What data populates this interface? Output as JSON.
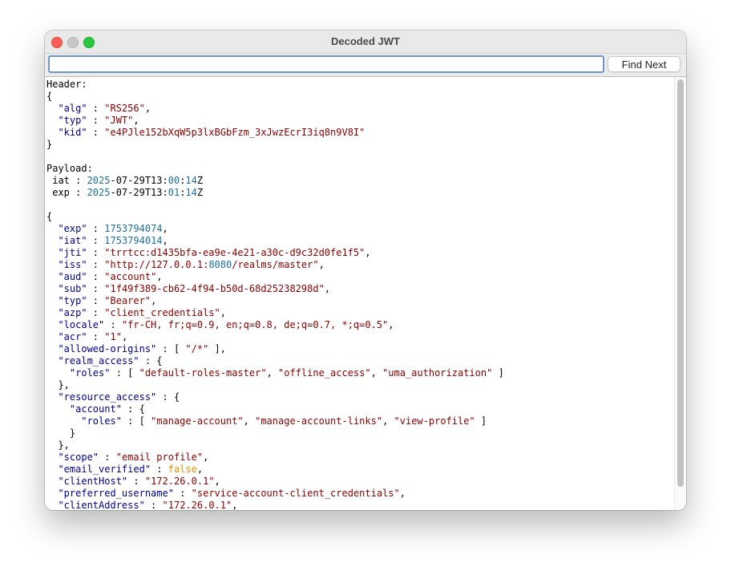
{
  "window": {
    "title": "Decoded JWT"
  },
  "find": {
    "value": "",
    "button_label": "Find Next"
  },
  "lines": [
    [
      {
        "t": "Header:",
        "c": ""
      }
    ],
    [
      {
        "t": "{",
        "c": ""
      }
    ],
    [
      {
        "t": "  ",
        "c": ""
      },
      {
        "t": "\"alg\"",
        "c": "k"
      },
      {
        "t": " : ",
        "c": ""
      },
      {
        "t": "\"RS256\"",
        "c": "s"
      },
      {
        "t": ",",
        "c": ""
      }
    ],
    [
      {
        "t": "  ",
        "c": ""
      },
      {
        "t": "\"typ\"",
        "c": "k"
      },
      {
        "t": " : ",
        "c": ""
      },
      {
        "t": "\"JWT\"",
        "c": "s"
      },
      {
        "t": ",",
        "c": ""
      }
    ],
    [
      {
        "t": "  ",
        "c": ""
      },
      {
        "t": "\"kid\"",
        "c": "k"
      },
      {
        "t": " : ",
        "c": ""
      },
      {
        "t": "\"e4PJle152bXqW5p3lxBGbFzm_3xJwzEcrI3iq8n9V8I\"",
        "c": "s"
      }
    ],
    [
      {
        "t": "}",
        "c": ""
      }
    ],
    [
      {
        "t": "",
        "c": ""
      }
    ],
    [
      {
        "t": "Payload:",
        "c": ""
      }
    ],
    [
      {
        "t": " iat : ",
        "c": ""
      },
      {
        "t": "2025",
        "c": "n"
      },
      {
        "t": "-07-29T13:",
        "c": ""
      },
      {
        "t": "00",
        "c": "n"
      },
      {
        "t": ":",
        "c": ""
      },
      {
        "t": "14",
        "c": "n"
      },
      {
        "t": "Z",
        "c": ""
      }
    ],
    [
      {
        "t": " exp : ",
        "c": ""
      },
      {
        "t": "2025",
        "c": "n"
      },
      {
        "t": "-07-29T13:",
        "c": ""
      },
      {
        "t": "01",
        "c": "n"
      },
      {
        "t": ":",
        "c": ""
      },
      {
        "t": "14",
        "c": "n"
      },
      {
        "t": "Z",
        "c": ""
      }
    ],
    [
      {
        "t": "",
        "c": ""
      }
    ],
    [
      {
        "t": "{",
        "c": ""
      }
    ],
    [
      {
        "t": "  ",
        "c": ""
      },
      {
        "t": "\"exp\"",
        "c": "k"
      },
      {
        "t": " : ",
        "c": ""
      },
      {
        "t": "1753794074",
        "c": "n"
      },
      {
        "t": ",",
        "c": ""
      }
    ],
    [
      {
        "t": "  ",
        "c": ""
      },
      {
        "t": "\"iat\"",
        "c": "k"
      },
      {
        "t": " : ",
        "c": ""
      },
      {
        "t": "1753794014",
        "c": "n"
      },
      {
        "t": ",",
        "c": ""
      }
    ],
    [
      {
        "t": "  ",
        "c": ""
      },
      {
        "t": "\"jti\"",
        "c": "k"
      },
      {
        "t": " : ",
        "c": ""
      },
      {
        "t": "\"trrtcc:d1435bfa-ea9e-4e21-a30c-d9c32d0fe1f5\"",
        "c": "s"
      },
      {
        "t": ",",
        "c": ""
      }
    ],
    [
      {
        "t": "  ",
        "c": ""
      },
      {
        "t": "\"iss\"",
        "c": "k"
      },
      {
        "t": " : ",
        "c": ""
      },
      {
        "t": "\"http://127.0.0.1:",
        "c": "s"
      },
      {
        "t": "8080",
        "c": "n"
      },
      {
        "t": "/realms/master\"",
        "c": "s"
      },
      {
        "t": ",",
        "c": ""
      }
    ],
    [
      {
        "t": "  ",
        "c": ""
      },
      {
        "t": "\"aud\"",
        "c": "k"
      },
      {
        "t": " : ",
        "c": ""
      },
      {
        "t": "\"account\"",
        "c": "s"
      },
      {
        "t": ",",
        "c": ""
      }
    ],
    [
      {
        "t": "  ",
        "c": ""
      },
      {
        "t": "\"sub\"",
        "c": "k"
      },
      {
        "t": " : ",
        "c": ""
      },
      {
        "t": "\"1f49f389-cb62-4f94-b50d-68d25238298d\"",
        "c": "s"
      },
      {
        "t": ",",
        "c": ""
      }
    ],
    [
      {
        "t": "  ",
        "c": ""
      },
      {
        "t": "\"typ\"",
        "c": "k"
      },
      {
        "t": " : ",
        "c": ""
      },
      {
        "t": "\"Bearer\"",
        "c": "s"
      },
      {
        "t": ",",
        "c": ""
      }
    ],
    [
      {
        "t": "  ",
        "c": ""
      },
      {
        "t": "\"azp\"",
        "c": "k"
      },
      {
        "t": " : ",
        "c": ""
      },
      {
        "t": "\"client_credentials\"",
        "c": "s"
      },
      {
        "t": ",",
        "c": ""
      }
    ],
    [
      {
        "t": "  ",
        "c": ""
      },
      {
        "t": "\"locale\"",
        "c": "k"
      },
      {
        "t": " : ",
        "c": ""
      },
      {
        "t": "\"fr-CH, fr;q=0.9, en;q=0.8, de;q=0.7, *;q=0.5\"",
        "c": "s"
      },
      {
        "t": ",",
        "c": ""
      }
    ],
    [
      {
        "t": "  ",
        "c": ""
      },
      {
        "t": "\"acr\"",
        "c": "k"
      },
      {
        "t": " : ",
        "c": ""
      },
      {
        "t": "\"1\"",
        "c": "s"
      },
      {
        "t": ",",
        "c": ""
      }
    ],
    [
      {
        "t": "  ",
        "c": ""
      },
      {
        "t": "\"allowed-origins\"",
        "c": "k"
      },
      {
        "t": " : [ ",
        "c": ""
      },
      {
        "t": "\"/*\"",
        "c": "s"
      },
      {
        "t": " ],",
        "c": ""
      }
    ],
    [
      {
        "t": "  ",
        "c": ""
      },
      {
        "t": "\"realm_access\"",
        "c": "k"
      },
      {
        "t": " : {",
        "c": ""
      }
    ],
    [
      {
        "t": "    ",
        "c": ""
      },
      {
        "t": "\"roles\"",
        "c": "k"
      },
      {
        "t": " : [ ",
        "c": ""
      },
      {
        "t": "\"default-roles-master\"",
        "c": "s"
      },
      {
        "t": ", ",
        "c": ""
      },
      {
        "t": "\"offline_access\"",
        "c": "s"
      },
      {
        "t": ", ",
        "c": ""
      },
      {
        "t": "\"uma_authorization\"",
        "c": "s"
      },
      {
        "t": " ]",
        "c": ""
      }
    ],
    [
      {
        "t": "  },",
        "c": ""
      }
    ],
    [
      {
        "t": "  ",
        "c": ""
      },
      {
        "t": "\"resource_access\"",
        "c": "k"
      },
      {
        "t": " : {",
        "c": ""
      }
    ],
    [
      {
        "t": "    ",
        "c": ""
      },
      {
        "t": "\"account\"",
        "c": "k"
      },
      {
        "t": " : {",
        "c": ""
      }
    ],
    [
      {
        "t": "      ",
        "c": ""
      },
      {
        "t": "\"roles\"",
        "c": "k"
      },
      {
        "t": " : [ ",
        "c": ""
      },
      {
        "t": "\"manage-account\"",
        "c": "s"
      },
      {
        "t": ", ",
        "c": ""
      },
      {
        "t": "\"manage-account-links\"",
        "c": "s"
      },
      {
        "t": ", ",
        "c": ""
      },
      {
        "t": "\"view-profile\"",
        "c": "s"
      },
      {
        "t": " ]",
        "c": ""
      }
    ],
    [
      {
        "t": "    }",
        "c": ""
      }
    ],
    [
      {
        "t": "  },",
        "c": ""
      }
    ],
    [
      {
        "t": "  ",
        "c": ""
      },
      {
        "t": "\"scope\"",
        "c": "k"
      },
      {
        "t": " : ",
        "c": ""
      },
      {
        "t": "\"email profile\"",
        "c": "s"
      },
      {
        "t": ",",
        "c": ""
      }
    ],
    [
      {
        "t": "  ",
        "c": ""
      },
      {
        "t": "\"email_verified\"",
        "c": "k"
      },
      {
        "t": " : ",
        "c": ""
      },
      {
        "t": "false",
        "c": "b"
      },
      {
        "t": ",",
        "c": ""
      }
    ],
    [
      {
        "t": "  ",
        "c": ""
      },
      {
        "t": "\"clientHost\"",
        "c": "k"
      },
      {
        "t": " : ",
        "c": ""
      },
      {
        "t": "\"172.26.0.1\"",
        "c": "s"
      },
      {
        "t": ",",
        "c": ""
      }
    ],
    [
      {
        "t": "  ",
        "c": ""
      },
      {
        "t": "\"preferred_username\"",
        "c": "k"
      },
      {
        "t": " : ",
        "c": ""
      },
      {
        "t": "\"service-account-client_credentials\"",
        "c": "s"
      },
      {
        "t": ",",
        "c": ""
      }
    ],
    [
      {
        "t": "  ",
        "c": ""
      },
      {
        "t": "\"clientAddress\"",
        "c": "k"
      },
      {
        "t": " : ",
        "c": ""
      },
      {
        "t": "\"172.26.0.1\"",
        "c": "s"
      },
      {
        "t": ",",
        "c": ""
      }
    ]
  ]
}
